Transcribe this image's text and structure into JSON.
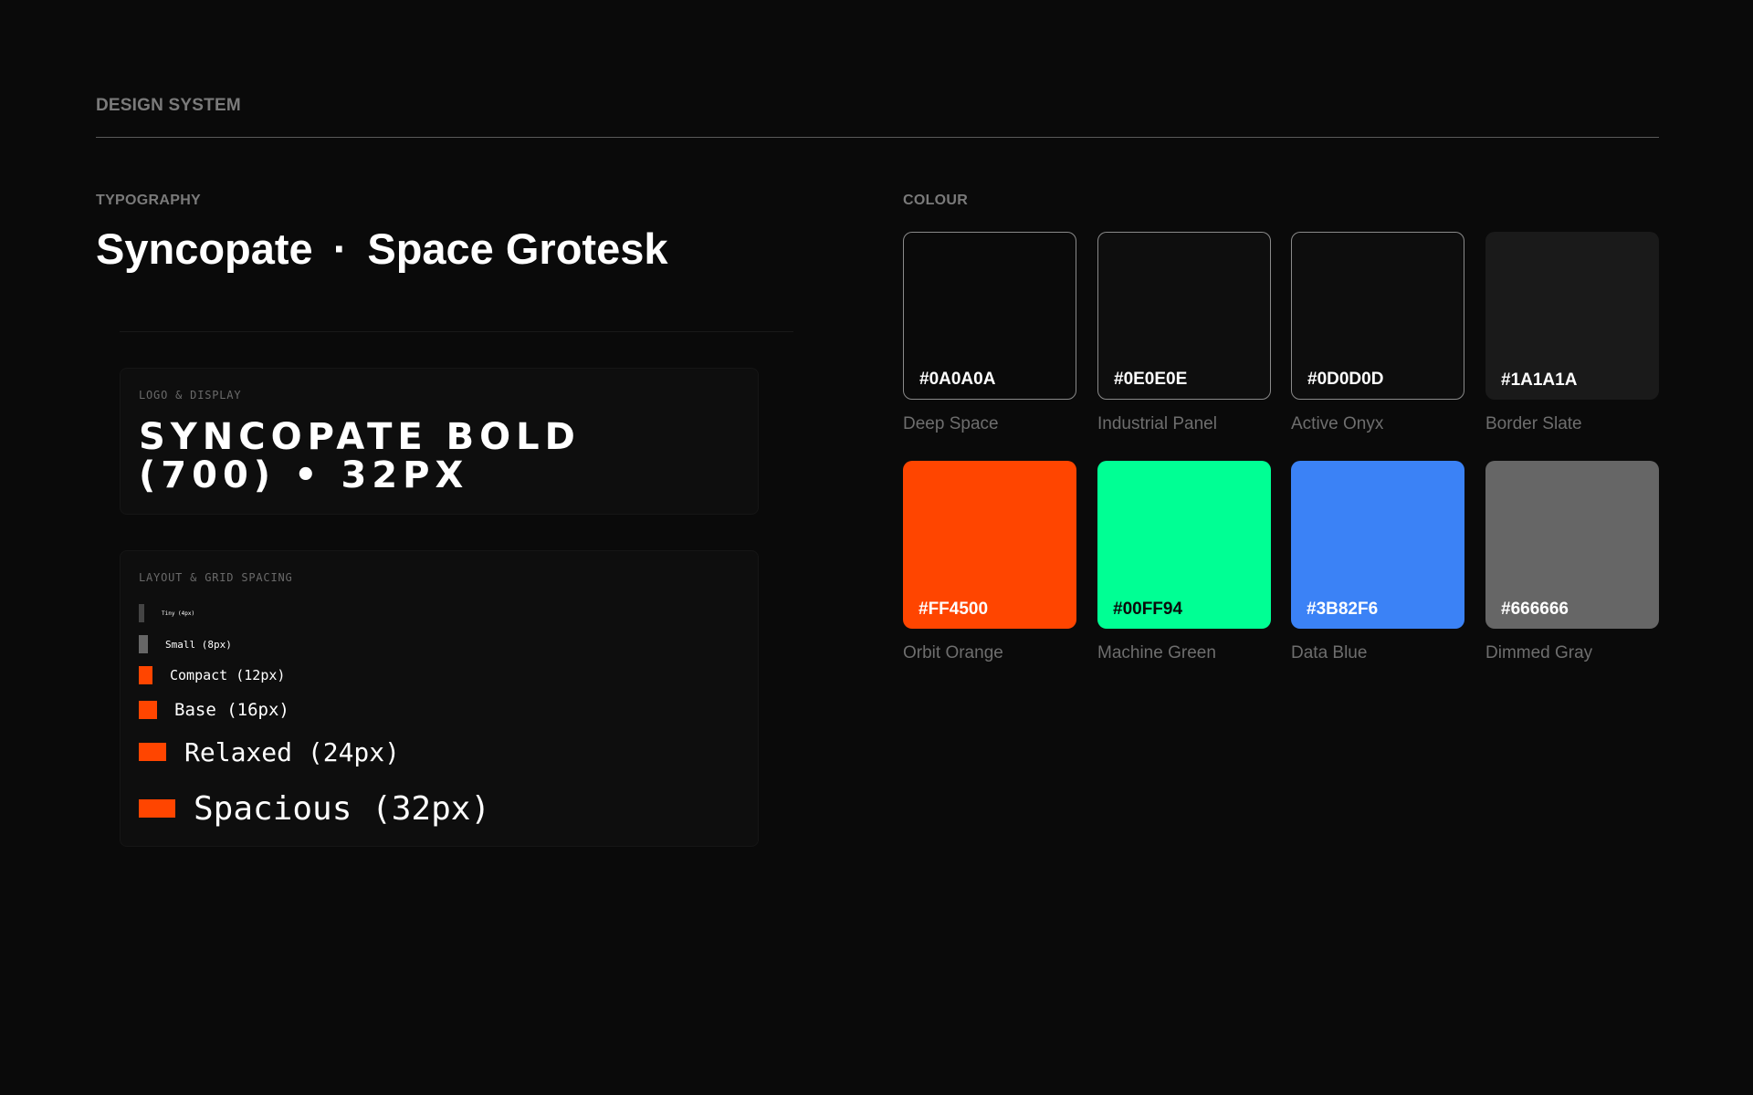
{
  "header": {
    "title": "DESIGN SYSTEM"
  },
  "typography": {
    "label": "TYPOGRAPHY",
    "font_primary": "Syncopate",
    "separator": "·",
    "font_secondary": "Space Grotesk",
    "display_panel": {
      "label": "LOGO & DISPLAY",
      "sample": "SYNCOPATE BOLD (700) • 32PX"
    },
    "spacing_panel": {
      "label": "LAYOUT & GRID SPACING",
      "items": [
        {
          "label": "Tiny (4px)",
          "color": "#444444"
        },
        {
          "label": "Small (8px)",
          "color": "#666666"
        },
        {
          "label": "Compact (12px)",
          "color": "#FF4500"
        },
        {
          "label": "Base (16px)",
          "color": "#FF4500"
        },
        {
          "label": "Relaxed (24px)",
          "color": "#FF4500"
        },
        {
          "label": "Spacious (32px)",
          "color": "#FF4500"
        }
      ]
    }
  },
  "colour": {
    "label": "COLOUR",
    "swatches": [
      {
        "hex": "#0A0A0A",
        "name": "Deep Space",
        "color": "#0A0A0A",
        "text_color": "#FFFFFF",
        "outlined": true
      },
      {
        "hex": "#0E0E0E",
        "name": "Industrial Panel",
        "color": "#0E0E0E",
        "text_color": "#FFFFFF",
        "outlined": true
      },
      {
        "hex": "#0D0D0D",
        "name": "Active Onyx",
        "color": "#0D0D0D",
        "text_color": "#FFFFFF",
        "outlined": true
      },
      {
        "hex": "#1A1A1A",
        "name": "Border Slate",
        "color": "#1A1A1A",
        "text_color": "#FFFFFF",
        "outlined": false
      },
      {
        "hex": "#FF4500",
        "name": "Orbit Orange",
        "color": "#FF4500",
        "text_color": "#FFFFFF",
        "outlined": false
      },
      {
        "hex": "#00FF94",
        "name": "Machine Green",
        "color": "#00FF94",
        "text_color": "#0A0A0A",
        "outlined": false
      },
      {
        "hex": "#3B82F6",
        "name": "Data Blue",
        "color": "#3B82F6",
        "text_color": "#FFFFFF",
        "outlined": false
      },
      {
        "hex": "#666666",
        "name": "Dimmed Gray",
        "color": "#666666",
        "text_color": "#FFFFFF",
        "outlined": false
      }
    ]
  }
}
